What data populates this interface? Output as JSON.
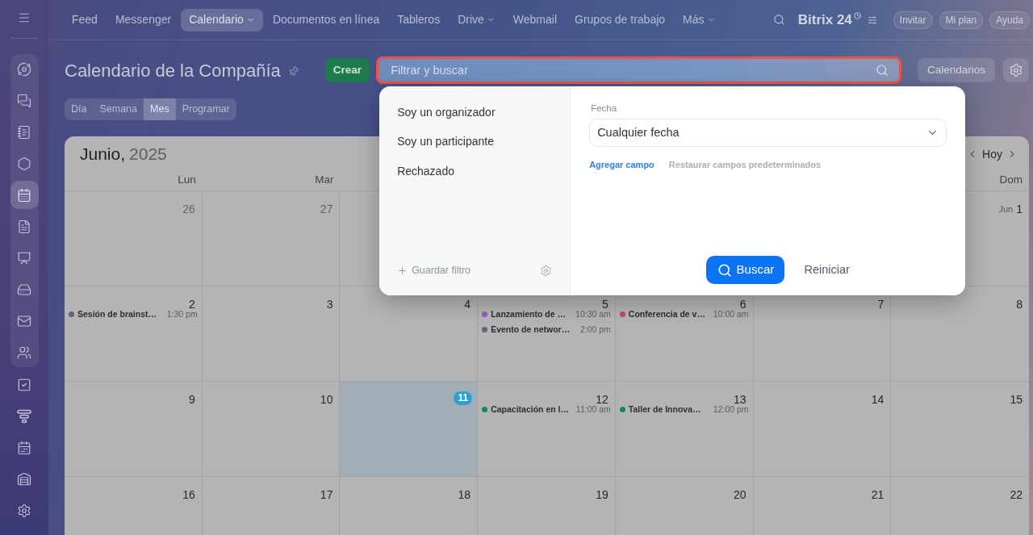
{
  "sidebar": {
    "panel_items": [
      {
        "selected": false
      },
      {
        "selected": false
      },
      {
        "selected": false
      },
      {
        "selected": false
      },
      {
        "selected": true
      },
      {
        "selected": false
      },
      {
        "selected": false
      },
      {
        "selected": false
      },
      {
        "selected": false
      },
      {
        "selected": false
      }
    ],
    "items": [
      {
        "selected": false
      },
      {
        "selected": false
      },
      {
        "selected": false
      },
      {
        "selected": false
      },
      {
        "selected": false
      }
    ]
  },
  "top_nav": {
    "items": [
      {
        "label": "Feed",
        "selected": false,
        "has_menu": false
      },
      {
        "label": "Messenger",
        "selected": false,
        "has_menu": false
      },
      {
        "label": "Calendario",
        "selected": true,
        "has_menu": true
      },
      {
        "label": "Documentos en línea",
        "selected": false,
        "has_menu": false
      },
      {
        "label": "Tableros",
        "selected": false,
        "has_menu": false
      },
      {
        "label": "Drive",
        "selected": false,
        "has_menu": true
      },
      {
        "label": "Webmail",
        "selected": false,
        "has_menu": false
      },
      {
        "label": "Grupos de trabajo",
        "selected": false,
        "has_menu": false
      },
      {
        "label": "Más",
        "selected": false,
        "has_menu": true
      }
    ],
    "logo": "Bitrix 24",
    "buttons": [
      "Invitar",
      "Mi plan",
      "Ayuda"
    ]
  },
  "toolbar": {
    "title": "Calendario de la Compañía",
    "create_button": "Crear",
    "search": {
      "placeholder": "Filtrar y buscar",
      "highlighted": true
    },
    "calendars_button": "Calendarios"
  },
  "view_tabs": [
    {
      "label": "Día",
      "selected": false
    },
    {
      "label": "Semana",
      "selected": false
    },
    {
      "label": "Mes",
      "selected": true
    },
    {
      "label": "Programar",
      "selected": false
    }
  ],
  "calendar": {
    "month": "Junio,",
    "year": "2025",
    "today_button": "Hoy",
    "weekdays_start": [
      "Lun",
      "Mar"
    ],
    "weekdays_end": [
      "Dom"
    ],
    "weeks": [
      {
        "days_start": [
          {
            "day": "26",
            "other_month": true,
            "today": false
          },
          {
            "day": "27",
            "other_month": true,
            "today": false
          }
        ],
        "days_end": [
          {
            "month": "Jun",
            "day": "1",
            "other_month": false,
            "today": false
          }
        ]
      },
      {
        "days": [
          {
            "day": "2",
            "other_month": false,
            "today": false,
            "events": [
              {
                "title": "Sesión de brainst…",
                "time": "1:30 pm",
                "color": "#5f6673"
              }
            ]
          },
          {
            "day": "3",
            "other_month": false,
            "today": false
          },
          {
            "day": "4",
            "other_month": false,
            "today": false
          },
          {
            "day": "5",
            "other_month": false,
            "today": false,
            "events": [
              {
                "title": "Lanzamiento de …",
                "time": "10:30 am",
                "color": "#a25bb5"
              },
              {
                "title": "Evento de networ…",
                "time": "2:00 pm",
                "color": "#5f6673"
              }
            ]
          },
          {
            "day": "6",
            "other_month": false,
            "today": false,
            "events": [
              {
                "title": "Conferencia de v…",
                "time": "10:00 am",
                "color": "#c44a6b"
              }
            ]
          },
          {
            "day": "7",
            "other_month": false,
            "today": false
          },
          {
            "day": "8",
            "other_month": false,
            "today": false
          }
        ]
      },
      {
        "days": [
          {
            "day": "9",
            "other_month": false,
            "today": false
          },
          {
            "day": "10",
            "other_month": false,
            "today": false
          },
          {
            "day": "11",
            "other_month": false,
            "today": true
          },
          {
            "day": "12",
            "other_month": false,
            "today": false,
            "events": [
              {
                "title": "Capacitación en l…",
                "time": "11:00 am",
                "color": "#0e8a5a"
              }
            ]
          },
          {
            "day": "13",
            "other_month": false,
            "today": false,
            "events": [
              {
                "title": "Taller de Innova…",
                "time": "12:00 pm",
                "color": "#0e8a5a"
              }
            ]
          },
          {
            "day": "14",
            "other_month": false,
            "today": false
          },
          {
            "day": "15",
            "other_month": false,
            "today": false
          }
        ]
      },
      {
        "days": [
          {
            "day": "16",
            "other_month": false,
            "today": false
          },
          {
            "day": "17",
            "other_month": false,
            "today": false
          },
          {
            "day": "18",
            "other_month": false,
            "today": false
          },
          {
            "day": "19",
            "other_month": false,
            "today": false
          },
          {
            "day": "20",
            "other_month": false,
            "today": false
          },
          {
            "day": "21",
            "other_month": false,
            "today": false
          },
          {
            "day": "22",
            "other_month": false,
            "today": false
          }
        ]
      }
    ]
  },
  "filter_popup": {
    "presets": [
      "Soy un organizador",
      "Soy un participante",
      "Rechazado"
    ],
    "save_filter": "Guardar filtro",
    "fields": [
      {
        "label": "Fecha",
        "value": "Cualquier fecha"
      }
    ],
    "add_field": "Agregar campo",
    "restore_fields": "Restaurar campos predeterminados",
    "search_button": "Buscar",
    "reset_button": "Reiniciar"
  }
}
